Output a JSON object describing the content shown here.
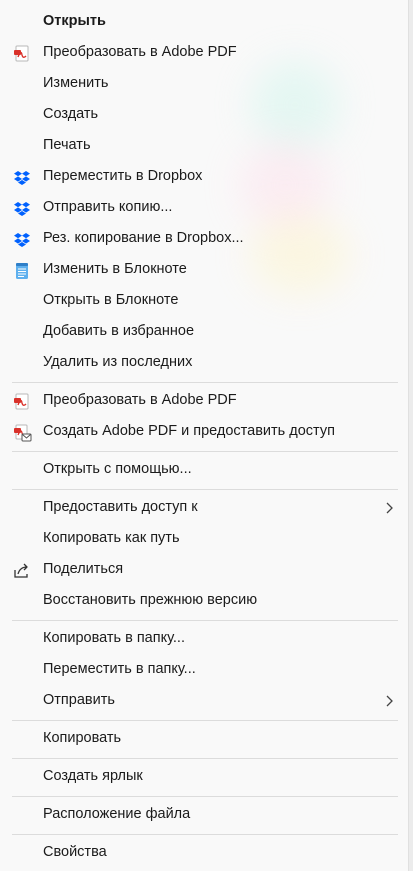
{
  "menu": {
    "items": [
      {
        "label": "Открыть",
        "icon": "",
        "bold": true
      },
      {
        "label": "Преобразовать в Adobe PDF",
        "icon": "adobe-pdf-icon"
      },
      {
        "label": "Изменить",
        "icon": ""
      },
      {
        "label": "Создать",
        "icon": ""
      },
      {
        "label": "Печать",
        "icon": ""
      },
      {
        "label": "Переместить в Dropbox",
        "icon": "dropbox-icon"
      },
      {
        "label": "Отправить копию...",
        "icon": "dropbox-icon"
      },
      {
        "label": "Рез. копирование в Dropbox...",
        "icon": "dropbox-icon"
      },
      {
        "label": "Изменить в Блокноте",
        "icon": "notepad-icon"
      },
      {
        "label": "Открыть в Блокноте",
        "icon": ""
      },
      {
        "label": "Добавить в избранное",
        "icon": ""
      },
      {
        "label": "Удалить из последних",
        "icon": ""
      },
      {
        "label": "Преобразовать в Adobe PDF",
        "icon": "adobe-pdf-icon"
      },
      {
        "label": "Создать Adobe PDF и предоставить доступ",
        "icon": "adobe-pdf-share-icon"
      },
      {
        "label": "Открыть с помощью...",
        "icon": ""
      },
      {
        "label": "Предоставить доступ к",
        "icon": "",
        "submenu": true
      },
      {
        "label": "Копировать как путь",
        "icon": ""
      },
      {
        "label": "Поделиться",
        "icon": "share-icon"
      },
      {
        "label": "Восстановить прежнюю версию",
        "icon": ""
      },
      {
        "label": "Копировать в папку...",
        "icon": ""
      },
      {
        "label": "Переместить в папку...",
        "icon": ""
      },
      {
        "label": "Отправить",
        "icon": "",
        "submenu": true
      },
      {
        "label": "Копировать",
        "icon": ""
      },
      {
        "label": "Создать ярлык",
        "icon": ""
      },
      {
        "label": "Расположение файла",
        "icon": ""
      },
      {
        "label": "Свойства",
        "icon": ""
      }
    ]
  },
  "colors": {
    "dropbox": "#0061fe",
    "adobe_red": "#d9312a",
    "notepad": "#3a8fd8"
  }
}
